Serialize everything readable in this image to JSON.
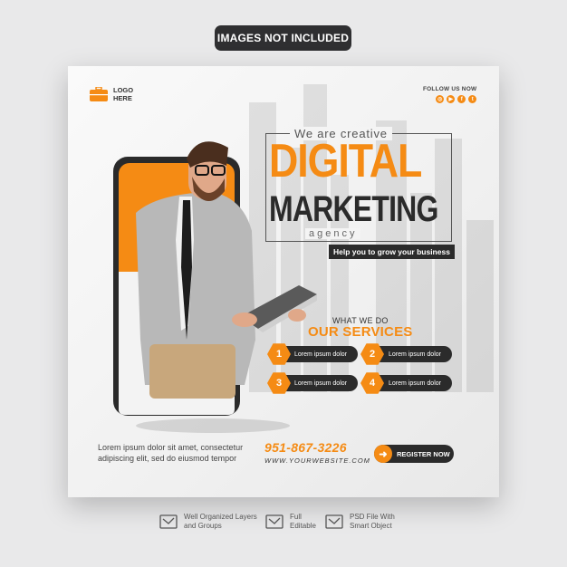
{
  "banner": {
    "label": "IMAGES NOT INCLUDED"
  },
  "post": {
    "logo": {
      "line1": "LOGO",
      "line2": "HERE",
      "icon": "briefcase-icon"
    },
    "follow": {
      "label": "FOLLOW US NOW",
      "icons": [
        "instagram-icon",
        "youtube-icon",
        "facebook-icon",
        "twitter-icon"
      ]
    },
    "headline": {
      "kicker": "We are creative",
      "line1": "DIGITAL",
      "line2": "MARKETING",
      "line3": "agency",
      "tagline": "Help you to grow your business"
    },
    "services": {
      "kicker": "WHAT WE DO",
      "title": "OUR SERVICES",
      "items": [
        {
          "num": "1",
          "label": "Lorem ipsum dolor"
        },
        {
          "num": "2",
          "label": "Lorem ipsum dolor"
        },
        {
          "num": "3",
          "label": "Lorem ipsum dolor"
        },
        {
          "num": "4",
          "label": "Lorem ipsum dolor"
        }
      ]
    },
    "footer": {
      "lorem1": "Lorem ipsum dolor sit amet, consectetur",
      "lorem2": "adipiscing elit, sed do eiusmod tempor",
      "phone": "951-867-3226",
      "website": "WWW.YOURWEBSITE.COM",
      "cta": "REGISTER NOW"
    }
  },
  "features": [
    {
      "line1": "Well Organized Layers",
      "line2": "and Groups",
      "icon": "layers-icon"
    },
    {
      "line1": "Full",
      "line2": "Editable",
      "icon": "edit-icon"
    },
    {
      "line1": "PSD File With",
      "line2": "Smart Object",
      "icon": "psd-file-icon"
    }
  ],
  "colors": {
    "accent": "#f58b14",
    "dark": "#2b2b2b",
    "background": "#e9e9ea"
  }
}
